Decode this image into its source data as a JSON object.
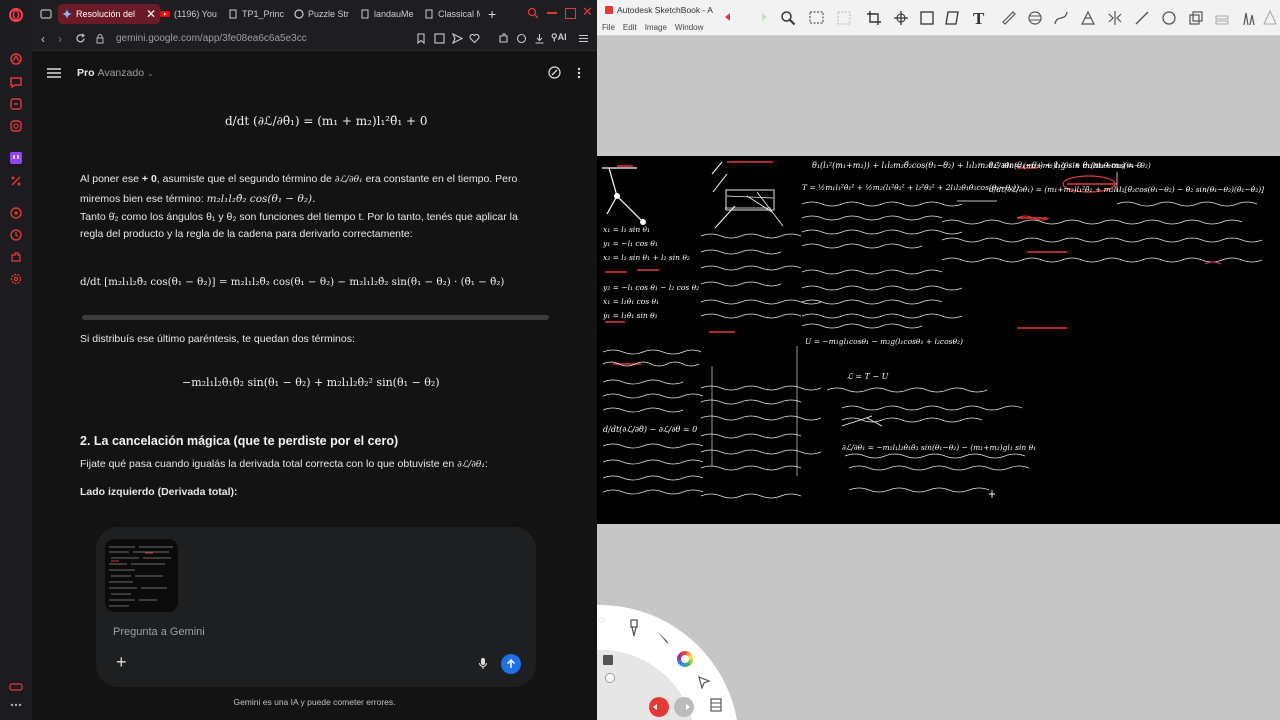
{
  "browser": {
    "tabs": [
      {
        "label": "Resolución del",
        "active": true
      },
      {
        "label": "(1196) You"
      },
      {
        "label": "TP1_Princ"
      },
      {
        "label": "Puzzle Str"
      },
      {
        "label": "landauMe"
      },
      {
        "label": "Classical M"
      }
    ],
    "url": "gemini.google.com/app/3fe08ea6c6a5e3cc",
    "ai_label": "AI"
  },
  "gemini": {
    "model_name": "Pro",
    "model_mode": "Avanzado",
    "eq1": "d/dt (∂ℒ/∂θ̇₁) = (m₁ + m₂)l₁²θ̈₁ + 0",
    "para1_line1_a": "Al poner ese",
    "para1_line1_b": "+ 0",
    "para1_line1_c": ", asumiste que el segundo término de",
    "para1_line1_d": "era constante en el tiempo. Pero",
    "para1_frac": "∂ℒ/∂θ₁",
    "para1_line2_a": "miremos bien ese término:",
    "para1_line2_math": "m₂l₁l₂θ̇₂ cos(θ₁ − θ₂).",
    "para2_line1": "Tanto θ̇₂ como los ángulos θ₁ y θ₂ son funciones del tiempo t. Por lo tanto, tenés que aplicar la",
    "para2_line2": "regla del producto y la regla de la cadena para derivarlo correctamente:",
    "eq2": "d/dt [m₂l₁l₂θ̇₂ cos(θ₁ − θ₂)] = m₂l₁l₂θ̈₂ cos(θ₁ − θ₂) − m₂l₁l₂θ̇₂ sin(θ₁ − θ₂) · (θ̇₁ − θ̇₂)",
    "para3": "Si distribuís ese último paréntesis, te quedan dos términos:",
    "eq3": "−m₂l₁l₂θ̇₁θ̇₂ sin(θ₁ − θ₂) + m₂l₁l₂θ̇₂² sin(θ₁ − θ₂)",
    "heading": "2. La cancelación mágica (que te perdiste por el cero)",
    "para4_text": "Fijate qué pasa cuando igualás la derivada total correcta con lo que obtuviste en",
    "para4_frac": "∂ℒ/∂θ₁",
    "para4_end": ":",
    "subheading": "Lado izquierdo (Derivada total):",
    "input_placeholder": "Pregunta a Gemini",
    "disclaimer": "Gemini es una IA y puede cometer errores."
  },
  "sketchbook": {
    "title": "Autodesk SketchBook - A",
    "menu": [
      "File",
      "Edit",
      "Image",
      "Window"
    ],
    "notes": [
      "θ̈₁(l₁²(m₁+m₂)) + l₁l₂m₂θ̈₂cos(θ₁−θ₂) + l₁l₂m₂θ̇₂² sin(θ₁−θ₂) + l₁g sin θ₁(m₁+m₂) = 0",
      "∂ℒ/∂θ̇₁ = (m₁+m₂)l₁²θ̇₁ + m₂l₁l₂θ̇₂cos(θ₁−θ₂)",
      "d/dt(∂ℒ/∂θ̇₁) = (m₁+m₂)l₁²θ̈₁ + m₂l₁l₂[θ̈₂cos(θ₁−θ₂) − θ̇₂ sin(θ₁−θ₂)(θ̇₁−θ̇₂)]",
      "T = ½m₁l₁²θ̇₁² + ½m₂(l₁²θ̇₁² + l₂²θ̇₂² + 2l₁l₂θ̇₁θ̇₂cos(θ₁−θ₂))",
      "U = −m₁gl₁cosθ₁ − m₂g(l₁cosθ₁ + l₂cosθ₂)",
      "ℒ = T − U",
      "∂ℒ/∂θ₁ = −m₂l₁l₂θ̇₁θ̇₂ sin(θ₁−θ₂) − (m₁+m₂)gl₁ sin θ₁",
      "x₁ = l₁ sin θ₁",
      "y₁ = −l₁ cos θ₁",
      "x₂ = l₁ sin θ₁ + l₂ sin θ₂",
      "y₂ = −l₁ cos θ₁ − l₂ cos θ₂",
      "ẋ₁ = l₁θ̇₁ cos θ₁",
      "ẏ₁ = l₁θ̇₁ sin θ₁",
      "d/dt(∂ℒ/∂θ̇) − ∂ℒ/∂θ = 0"
    ]
  },
  "colors": {
    "accent_red": "#e53935",
    "tab_active": "#6b1b28",
    "send_blue": "#1a73e8"
  }
}
